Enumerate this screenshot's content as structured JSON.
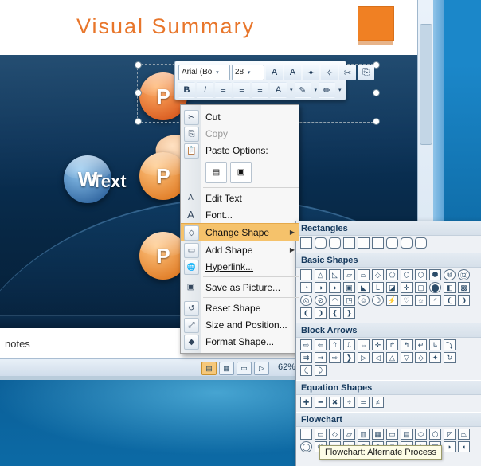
{
  "slide": {
    "title": "Visual Summary",
    "notes_text": "notes",
    "orbs": [
      {
        "name": "powerpoint",
        "letter": "P"
      },
      {
        "name": "word",
        "letter": "W",
        "label": "Text"
      },
      {
        "name": "excel-orange",
        "letter": "P"
      },
      {
        "name": "excel-lower",
        "letter": "P"
      }
    ]
  },
  "status_bar": {
    "zoom_percent": "62%",
    "zoom_out": "-",
    "zoom_in": "+",
    "views": [
      {
        "name": "normal-view",
        "glyph": "▤"
      },
      {
        "name": "slide-sorter-view",
        "glyph": "▦"
      },
      {
        "name": "reading-view",
        "glyph": "▭"
      },
      {
        "name": "slide-show-view",
        "glyph": "▷"
      }
    ]
  },
  "mini_toolbar": {
    "font_name": "Arial (Bo",
    "font_size": "28",
    "grow_font": "A",
    "shrink_font": "A",
    "buttons_row1": [
      "A",
      "A",
      "✦",
      "✧",
      "✂",
      "⎘"
    ],
    "bold": "B",
    "italic": "I",
    "align_left": "≡",
    "align_center": "≡",
    "align_right": "≡",
    "font_color": "A",
    "highlight": "✎",
    "format_painter": "✏"
  },
  "context_menu": {
    "items": [
      {
        "label": "Cut",
        "icon": "✂",
        "disabled": false,
        "submenu": false
      },
      {
        "label": "Copy",
        "icon": "⎘",
        "disabled": true,
        "submenu": false
      },
      {
        "label": "Paste Options:",
        "icon": "📋",
        "disabled": false,
        "submenu": false
      },
      {
        "label": "Edit Text",
        "icon": "A",
        "disabled": false,
        "submenu": false
      },
      {
        "label": "Font...",
        "icon": "A",
        "disabled": false,
        "submenu": false
      },
      {
        "label": "Change Shape",
        "icon": "◇",
        "disabled": false,
        "submenu": true,
        "highlighted": true
      },
      {
        "label": "Add Shape",
        "icon": "▭",
        "disabled": false,
        "submenu": true
      },
      {
        "label": "Hyperlink...",
        "icon": "🌐",
        "disabled": false,
        "submenu": false
      },
      {
        "label": "Save as Picture...",
        "icon": "▣",
        "disabled": false,
        "submenu": false
      },
      {
        "label": "Reset Shape",
        "icon": "↺",
        "disabled": false,
        "submenu": false
      },
      {
        "label": "Size and Position...",
        "icon": "⤢",
        "disabled": false,
        "submenu": false
      },
      {
        "label": "Format Shape...",
        "icon": "◆",
        "disabled": false,
        "submenu": false
      }
    ],
    "paste_icons": [
      "▤",
      "▣"
    ]
  },
  "shapes_gallery": {
    "sections": [
      {
        "title": "Rectangles",
        "rows": [
          [
            "▭",
            "▭",
            "▭",
            "▭",
            "▭",
            "▭",
            "▭",
            "▭",
            "▭"
          ]
        ]
      },
      {
        "title": "Basic Shapes",
        "rows": [
          [
            "▭",
            "△",
            "▱",
            "◇",
            "⬠",
            "⬡",
            "⬡",
            "⬢",
            "⬣",
            "◉",
            "◎"
          ],
          [
            "◔",
            "◑",
            "◖",
            "◗",
            "▤",
            "▥",
            "▦",
            "▧",
            "✛",
            "✚",
            "⬤"
          ],
          [
            "◯",
            "◎",
            "◻",
            "◠",
            "☺",
            "◐",
            "✎",
            "✧",
            "☾",
            "❛",
            "❜"
          ],
          [
            "❨",
            "❩",
            "❴",
            "❵"
          ]
        ]
      },
      {
        "title": "Block Arrows",
        "rows": [
          [
            "⇨",
            "⇦",
            "⇧",
            "⇩",
            "⇔",
            "✛",
            "⇱",
            "⇲",
            "⇳",
            "⇴",
            "⇵"
          ],
          [
            "⇨",
            "⇦",
            "⇧",
            "⇩",
            "⇪",
            "⇫",
            "⇬",
            "⇭",
            "⇮",
            "⇯",
            "⇰"
          ],
          [
            "⇱",
            "⇲"
          ]
        ]
      },
      {
        "title": "Equation Shapes",
        "rows": [
          [
            "✚",
            "−",
            "✖",
            "÷",
            "＝",
            "≠"
          ]
        ]
      },
      {
        "title": "Flowchart",
        "rows": [
          [
            "▭",
            "◇",
            "▱",
            "▭",
            "▭",
            "▭",
            "⬭",
            "⬯",
            "⬮",
            "⬬",
            "⬫"
          ],
          [
            "◯",
            "⬡",
            "⬢",
            "⬣",
            "⬤",
            "⬥",
            "⬦",
            "⬧",
            "⬨",
            "⬩",
            "◇"
          ]
        ]
      }
    ],
    "tooltip": "Flowchart: Alternate Process"
  }
}
